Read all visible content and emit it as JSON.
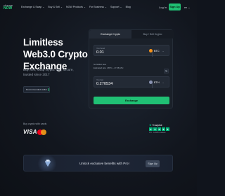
{
  "logo": {
    "line1": "change",
    "line2": "NOW"
  },
  "nav": {
    "items": [
      "Exchange & Swap ⌄",
      "Buy & Sell ⌄",
      "NOW Products ⌄",
      "For Business ⌄",
      "Support ⌄",
      "Blog"
    ],
    "login": "Log In",
    "signup": "Sign Up",
    "language": "en ⌄"
  },
  "hero": {
    "title": "Limitless Web3.0 Crypto Exchange",
    "subtitle": "Buy, sell, swap crypto: fast, secure, trusted since 2017",
    "badge": "Recommended wallet"
  },
  "payments": {
    "label": "Buy crypto with cards",
    "visa": "VISA"
  },
  "widget": {
    "tabs": [
      "Exchange Crypto",
      "Buy / Sell Crypto"
    ],
    "send": {
      "label": "You Send",
      "value": "0.01",
      "currency": "BTC",
      "icon_color": "#f7931a"
    },
    "get": {
      "label": "You Get",
      "value": "0.270534",
      "currency": "ETH",
      "icon_color": "#8a93b2"
    },
    "rates": [
      "No hidden fees",
      "Estimated rate: 1 BTC ~ 27.05 ETH"
    ],
    "swap_icon": "⇅",
    "exchange_button": "Exchange"
  },
  "trustpilot": {
    "brand": "Trustpilot",
    "stars": 5,
    "score": "4.5 · 12345 reviews"
  },
  "banner": {
    "text": "Unlock exclusive benefits with Pro!",
    "button": "Sign Up"
  },
  "colors": {
    "accent": "#20c074",
    "background": "#10141c",
    "card": "#1a2029"
  }
}
